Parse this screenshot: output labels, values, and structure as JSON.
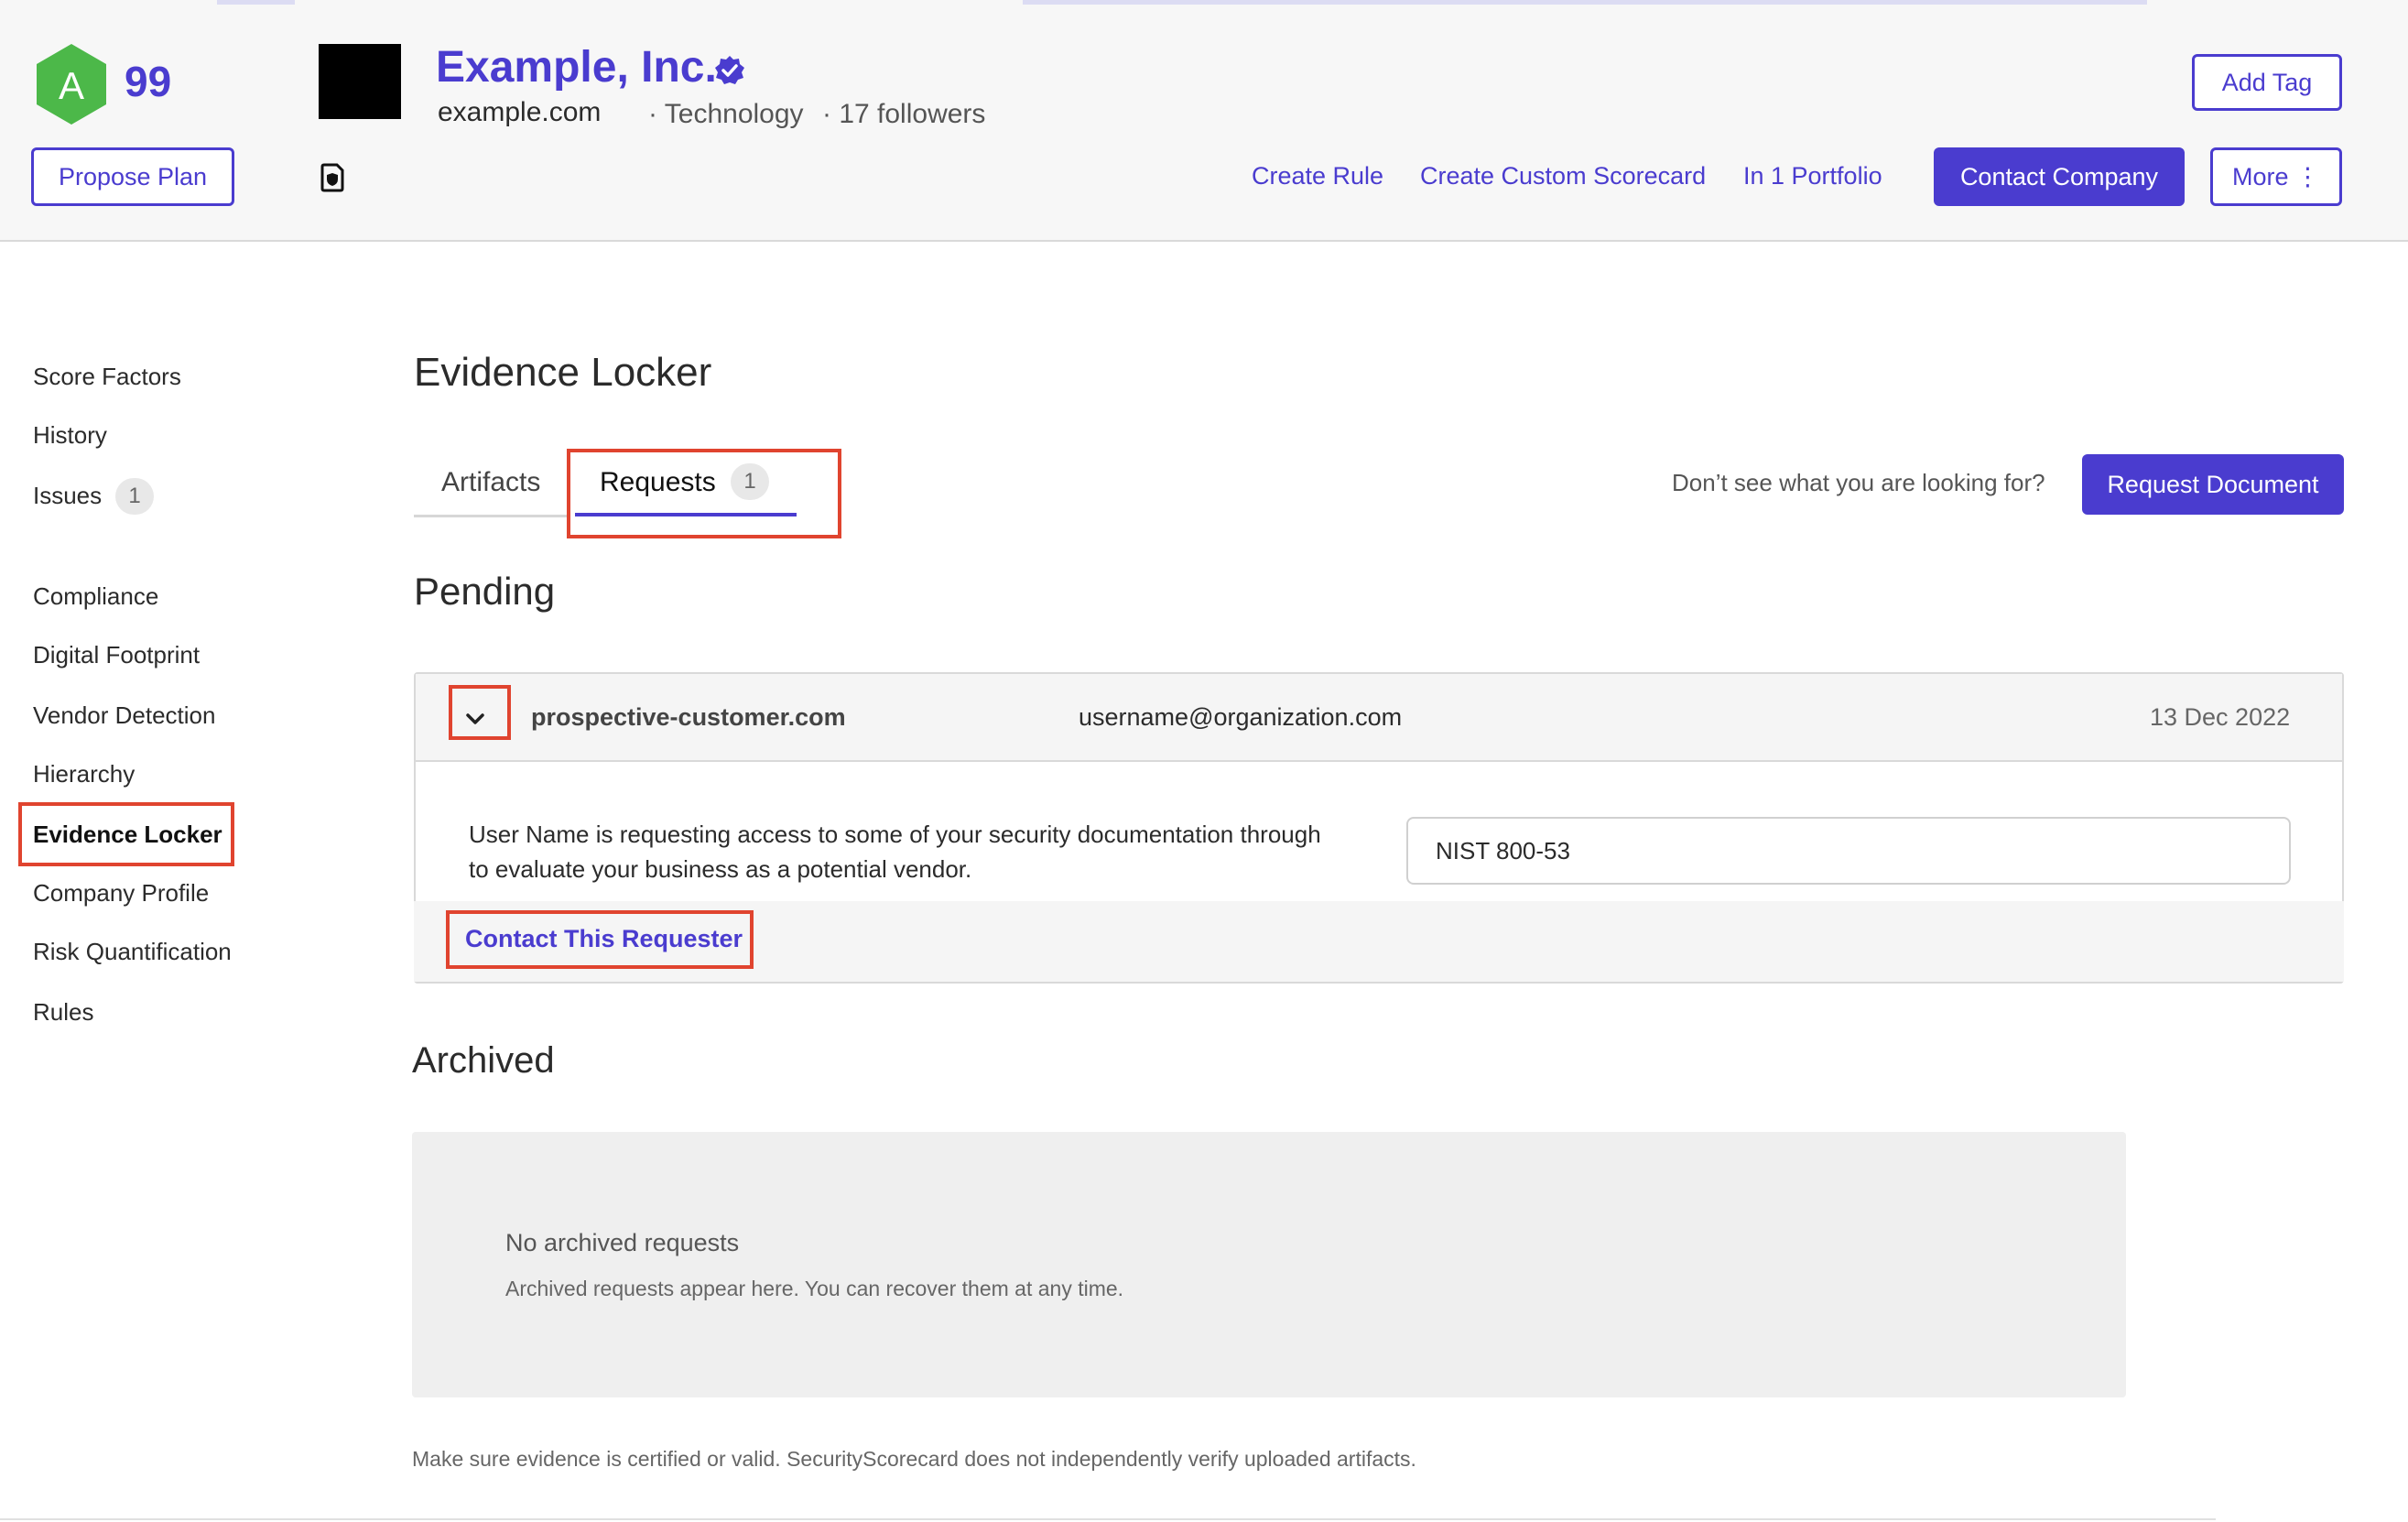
{
  "header": {
    "grade": "A",
    "score": "99",
    "company_name": "Example, Inc.",
    "domain": "example.com",
    "industry": "· Technology",
    "followers": "· 17 followers",
    "add_tag_label": "Add Tag",
    "propose_plan_label": "Propose Plan",
    "create_rule_label": "Create Rule",
    "create_scorecard_label": "Create Custom Scorecard",
    "portfolio_label": "In 1 Portfolio",
    "contact_company_label": "Contact Company",
    "more_label": "More ⋮"
  },
  "sidebar": {
    "items": [
      {
        "label": "Score Factors"
      },
      {
        "label": "History"
      },
      {
        "label": "Issues",
        "badge": "1"
      },
      {
        "label": "Compliance"
      },
      {
        "label": "Digital Footprint"
      },
      {
        "label": "Vendor Detection"
      },
      {
        "label": "Hierarchy"
      },
      {
        "label": "Evidence Locker"
      },
      {
        "label": "Company Profile"
      },
      {
        "label": "Risk Quantification"
      },
      {
        "label": "Rules"
      }
    ]
  },
  "main": {
    "title": "Evidence Locker",
    "tabs": [
      {
        "label": "Artifacts"
      },
      {
        "label": "Requests",
        "count": "1"
      }
    ],
    "prompt": "Don’t see what you are looking for?",
    "request_document_label": "Request Document",
    "pending_title": "Pending",
    "request": {
      "domain": "prospective-customer.com",
      "email": "username@organization.com",
      "date": "13 Dec 2022",
      "message_line1": "User Name is requesting access to some of your security documentation through",
      "message_line2": "to evaluate your business as a potential vendor.",
      "document": "NIST 800-53",
      "contact_label": "Contact This Requester"
    },
    "archived_title": "Archived",
    "archived_empty_title": "No archived requests",
    "archived_empty_sub": "Archived requests appear here. You can recover them at any time.",
    "disclaimer": "Make sure evidence is certified or valid. SecurityScorecard does not independently verify uploaded artifacts."
  },
  "colors": {
    "accent": "#4a3ccf",
    "grade_green": "#4cb849",
    "highlight_red": "#e0442f"
  }
}
